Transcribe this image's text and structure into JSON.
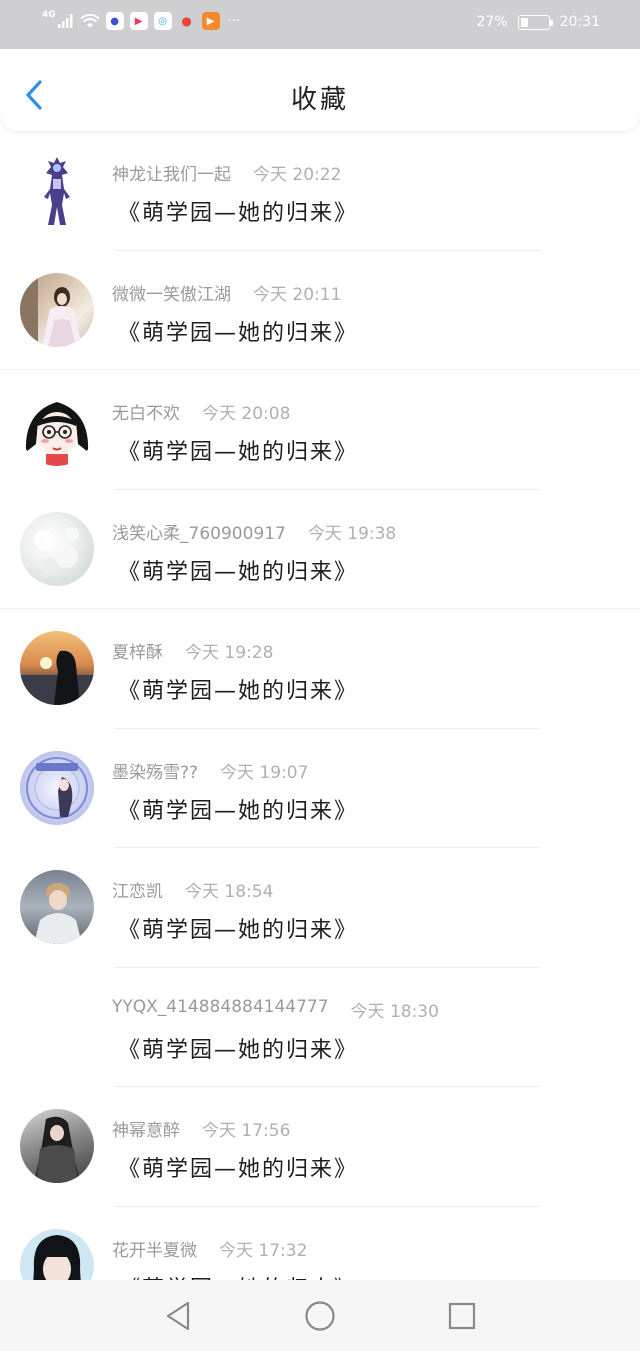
{
  "status_bar": {
    "network": "4G",
    "battery": "27%",
    "time": "20:31",
    "apps": [
      {
        "icon": "circle-app-icon",
        "color": "#3b4fd8",
        "glyph": "●"
      },
      {
        "icon": "youku-icon",
        "color": "#1e90ff",
        "glyph": "▶"
      },
      {
        "icon": "swirl-app-icon",
        "color": "#3aa7f0",
        "glyph": "◎"
      },
      {
        "icon": "red-app-icon",
        "color": "#e84a3a",
        "glyph": "●"
      },
      {
        "icon": "play-app-icon",
        "color": "#f28a2a",
        "glyph": "▶"
      }
    ],
    "more": "···"
  },
  "header": {
    "title": "收藏",
    "accent": "#2f8fe6"
  },
  "items": [
    {
      "author": "神龙让我们一起",
      "time": "今天 20:22",
      "title": "《萌学园—她的归来》",
      "avatar": "figure-avatar"
    },
    {
      "author": "微微一笑傲江湖",
      "time": "今天 20:11",
      "title": "《萌学园—她的归来》",
      "avatar": "photo-avatar"
    },
    {
      "author": "无白不欢",
      "time": "今天 20:08",
      "title": "《萌学园—她的归来》",
      "avatar": "cartoon-avatar"
    },
    {
      "author": "浅笑心柔_760900917",
      "time": "今天 19:38",
      "title": "《萌学园—她的归来》",
      "avatar": "pearl-avatar"
    },
    {
      "author": "夏梓酥",
      "time": "今天 19:28",
      "title": "《萌学园—她的归来》",
      "avatar": "sunset-avatar"
    },
    {
      "author": "墨染殇雪??",
      "time": "今天 19:07",
      "title": "《萌学园—她的归来》",
      "avatar": "anime-avatar"
    },
    {
      "author": "江恋凯",
      "time": "今天 18:54",
      "title": "《萌学园—她的归来》",
      "avatar": "boy-avatar"
    },
    {
      "author": "YYQX_414884884144777",
      "time": "今天 18:30",
      "title": "《萌学园—她的归来》",
      "avatar": "blank-avatar"
    },
    {
      "author": "神幂意醉",
      "time": "今天 17:56",
      "title": "《萌学园—她的归来》",
      "avatar": "dark-avatar"
    },
    {
      "author": "花开半夏微",
      "time": "今天 17:32",
      "title": "《萌学园—她的归来》",
      "avatar": "girl-avatar"
    }
  ]
}
